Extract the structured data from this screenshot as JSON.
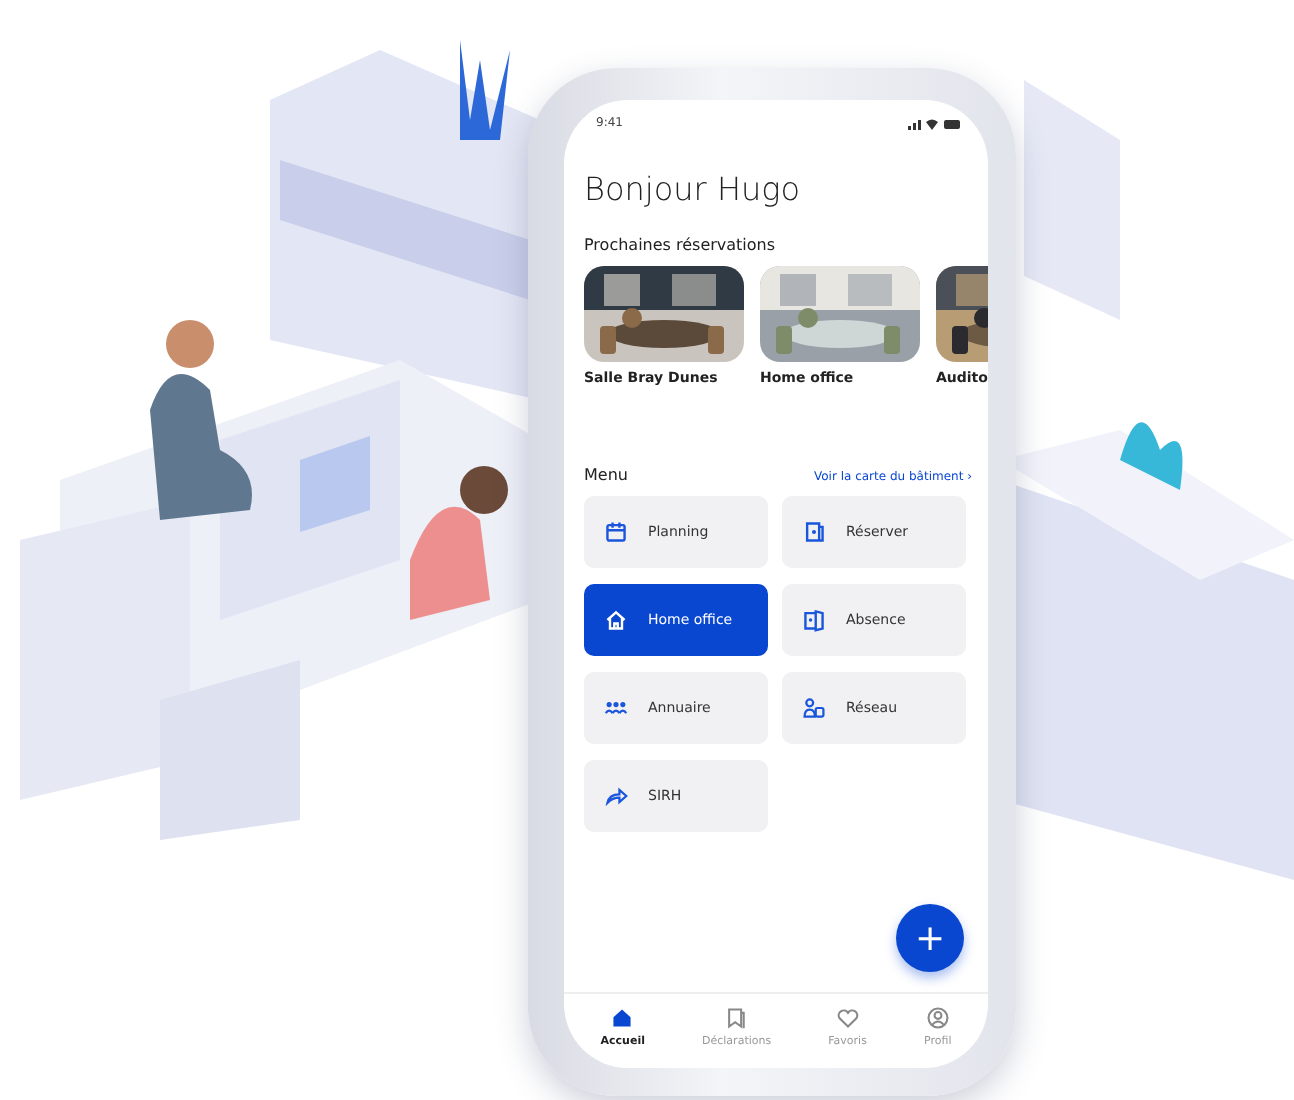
{
  "status_bar": {
    "time": "9:41"
  },
  "greeting": "Bonjour Hugo",
  "reservations": {
    "title": "Prochaines réservations",
    "cards": [
      {
        "title": "Salle Bray Dunes",
        "kind": "picture"
      },
      {
        "title": "Home office",
        "kind": "picture"
      },
      {
        "title": "Audito",
        "kind": "picture"
      }
    ]
  },
  "menu": {
    "title": "Menu",
    "link": "Voir la carte du bâtiment ›",
    "items": [
      {
        "label": "Planning",
        "selected": false
      },
      {
        "label": "Réserver",
        "selected": false
      },
      {
        "label": "Home office",
        "selected": true
      },
      {
        "label": "Absence",
        "selected": false
      },
      {
        "label": "Annuaire",
        "selected": false
      },
      {
        "label": "Réseau",
        "selected": false
      },
      {
        "label": "SIRH",
        "selected": false
      }
    ]
  },
  "fab": {
    "label": "+"
  },
  "nav": [
    {
      "label": "Accueil",
      "selected": true
    },
    {
      "label": "Déclarations",
      "selected": false
    },
    {
      "label": "Favoris",
      "selected": false
    },
    {
      "label": "Profil",
      "selected": false
    }
  ]
}
